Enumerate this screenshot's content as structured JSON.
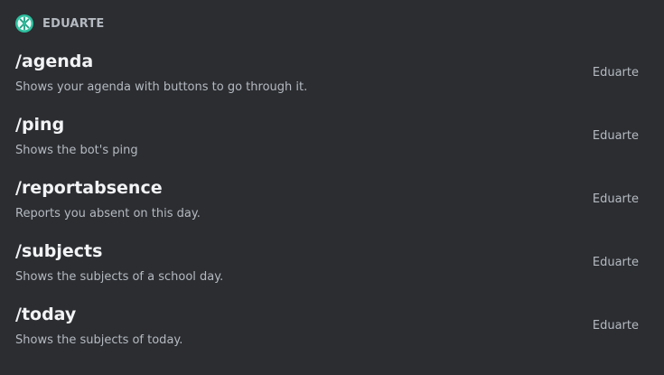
{
  "app": {
    "name": "EDUARTE",
    "icon": "eduarte-logo-icon",
    "icon_color": "#2dbf9f"
  },
  "commands": [
    {
      "name": "/agenda",
      "description": "Shows your agenda with buttons to go through it.",
      "app_label": "Eduarte"
    },
    {
      "name": "/ping",
      "description": "Shows the bot's ping",
      "app_label": "Eduarte"
    },
    {
      "name": "/reportabsence",
      "description": "Reports you absent on this day.",
      "app_label": "Eduarte"
    },
    {
      "name": "/subjects",
      "description": "Shows the subjects of a school day.",
      "app_label": "Eduarte"
    },
    {
      "name": "/today",
      "description": "Shows the subjects of today.",
      "app_label": "Eduarte"
    }
  ]
}
